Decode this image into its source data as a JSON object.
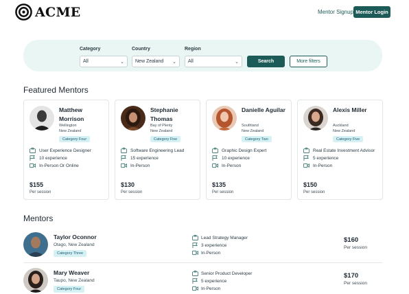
{
  "brand": {
    "name": "ACME"
  },
  "header": {
    "signup_label": "Mentor Signup",
    "login_label": "Mentor Login"
  },
  "search": {
    "category": {
      "label": "Category",
      "value": "All"
    },
    "country": {
      "label": "Country",
      "value": "New Zealand"
    },
    "region": {
      "label": "Region",
      "value": "All"
    },
    "search_label": "Search",
    "more_filters_label": "More filters"
  },
  "featured": {
    "title": "Featured Mentors",
    "cards": [
      {
        "name": "Matthew Morrison",
        "location_line1": "Wellington",
        "location_line2": "New Zealand",
        "category": "Category Four",
        "role": "User Experience Designer",
        "experience": "10 experience",
        "mode": "In-Person Or Online",
        "price": "$155",
        "per": "Per session"
      },
      {
        "name": "Stephanie Thomas",
        "location_line1": "Bay of Plenty",
        "location_line2": "New Zealand",
        "category": "Category Five",
        "role": "Software Engineering Lead",
        "experience": "15 experience",
        "mode": "In-Person",
        "price": "$130",
        "per": "Per session"
      },
      {
        "name": "Danielle Aguilar",
        "location_line1": "Southland",
        "location_line2": "New Zealand",
        "category": "Category Two",
        "role": "Graphic Design Expert",
        "experience": "10 experience",
        "mode": "In-Person",
        "price": "$135",
        "per": "Per session"
      },
      {
        "name": "Alexis Miller",
        "location_line1": "Auckland",
        "location_line2": "New Zealand",
        "category": "Category Five",
        "role": "Real Estate Investment Advisor",
        "experience": "5 experience",
        "mode": "In-Person",
        "price": "$150",
        "per": "Per session"
      }
    ]
  },
  "mentors": {
    "title": "Mentors",
    "rows": [
      {
        "name": "Taylor Oconnor",
        "location": "Otago, New Zealand",
        "category": "Category Three",
        "role": "Lead Strategy Manager",
        "experience": "3 experience",
        "mode": "In-Person",
        "price": "$160",
        "per": "Per session"
      },
      {
        "name": "Mary Weaver",
        "location": "Taupo, New Zealand",
        "category": "Category Four",
        "role": "Senior Product Developer",
        "experience": "5 experience",
        "mode": "In-Person",
        "price": "$170",
        "per": "Per session"
      }
    ]
  },
  "colors": {
    "primary": "#1c5b57",
    "panel": "#eaf6f4",
    "badge_bg": "#d6f1f4",
    "badge_text": "#1c5b73"
  }
}
